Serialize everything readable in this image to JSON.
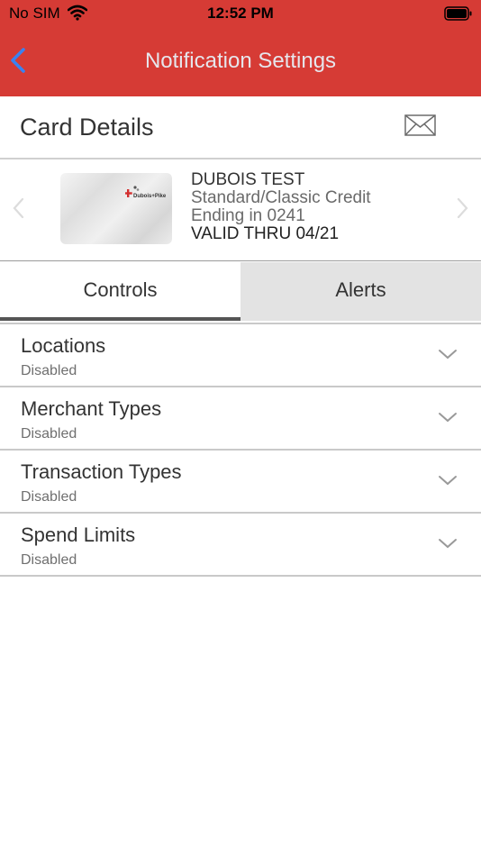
{
  "status_bar": {
    "carrier": "No SIM",
    "time": "12:52 PM",
    "icons": [
      "wifi-icon",
      "battery-icon"
    ]
  },
  "nav": {
    "title": "Notification Settings",
    "back_icon": "chevron-left-icon"
  },
  "card_details": {
    "title": "Card Details",
    "mail_icon": "envelope-icon"
  },
  "card": {
    "name": "DUBOIS TEST",
    "type": "Standard/Classic Credit",
    "ending": "Ending in 0241",
    "valid_thru": "VALID THRU 04/21",
    "logo_text": "Dubois+Pike"
  },
  "tabs": [
    {
      "label": "Controls",
      "selected": true
    },
    {
      "label": "Alerts",
      "selected": false
    }
  ],
  "controls": [
    {
      "title": "Locations",
      "status": "Disabled"
    },
    {
      "title": "Merchant Types",
      "status": "Disabled"
    },
    {
      "title": "Transaction Types",
      "status": "Disabled"
    },
    {
      "title": "Spend Limits",
      "status": "Disabled"
    }
  ],
  "colors": {
    "header_red": "#d63b35",
    "back_blue": "#3b82f0",
    "title_text": "#e6e6ec",
    "tab_inactive_bg": "#e3e3e3"
  }
}
